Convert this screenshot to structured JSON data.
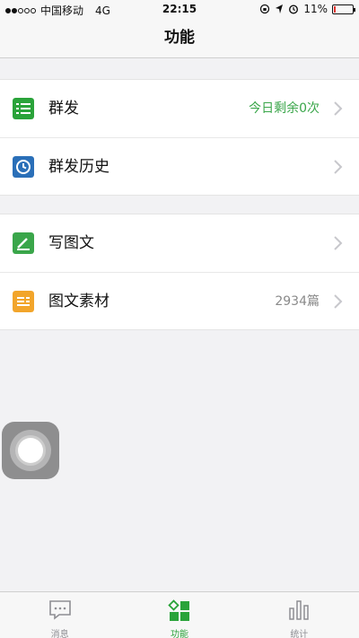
{
  "status": {
    "carrier": "中国移动",
    "network": "4G",
    "time": "22:15",
    "battery": "11%",
    "battery_level": 0.11
  },
  "nav": {
    "title": "功能"
  },
  "groups": [
    {
      "rows": [
        {
          "label": "群发",
          "detail": "今日剩余0次",
          "detail_color": "#3aa64a",
          "icon": "mass-send-icon",
          "icon_color": "#2aa33a"
        },
        {
          "label": "群发历史",
          "detail": "",
          "icon": "clock-icon",
          "icon_color": "#2a6fb8"
        }
      ]
    },
    {
      "rows": [
        {
          "label": "写图文",
          "detail": "",
          "icon": "pencil-icon",
          "icon_color": "#3aa64a"
        },
        {
          "label": "图文素材",
          "detail": "2934篇",
          "detail_color": "#8a8a8a",
          "icon": "article-icon",
          "icon_color": "#f2a52b"
        }
      ]
    }
  ],
  "tabs": [
    {
      "label": "消息",
      "icon": "message-icon",
      "active": false
    },
    {
      "label": "功能",
      "icon": "grid-icon",
      "active": true
    },
    {
      "label": "统计",
      "icon": "bar-chart-icon",
      "active": false
    }
  ],
  "colors": {
    "accent": "#2aa33a",
    "background": "#f2f2f4"
  }
}
